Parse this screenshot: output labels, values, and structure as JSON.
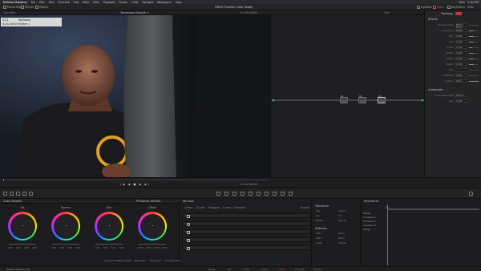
{
  "menubar": {
    "items": [
      "DaVinci Resolve",
      "File",
      "Edit",
      "Trim",
      "Timeline",
      "Clip",
      "Mark",
      "View",
      "Playback",
      "Fusion",
      "Color",
      "Fairlight",
      "Workspace",
      "Help"
    ],
    "right_items": [
      "Mon",
      "1:04 PM"
    ]
  },
  "toolbar": {
    "left_items": [
      "Media Pool",
      "Effects",
      "Gallery"
    ],
    "project_title": "FRESH Timeline (Color Grade)",
    "right_items": [
      "Lightbox",
      "Color",
      "Keyframes",
      "Clips"
    ]
  },
  "viewer": {
    "title": "Tennessee Rain/sh 1",
    "zoom": "Clip 54%",
    "timecode": "01:00:18:02",
    "osd": {
      "row1_left": "V1/1",
      "row1_right": "Keyframe",
      "row2_left": "01:02:16:03",
      "row2_right": "Marker 1"
    }
  },
  "node_editor": {
    "header": "Clip",
    "nodes": [
      {
        "label": "01"
      },
      {
        "label": "02"
      },
      {
        "label": "03"
      }
    ]
  },
  "inspector": {
    "header": "Tracking",
    "tab": "Effects",
    "rows": [
      {
        "label": "Process mode",
        "value": "Effects Fixed",
        "fill": 0
      },
      {
        "label": "Overshoot",
        "value": "0.000",
        "fill": 0.5
      },
      {
        "label": "Pan",
        "value": "0.000",
        "fill": 0.5
      },
      {
        "label": "Tilt",
        "value": "0.000",
        "fill": 0.5
      },
      {
        "label": "Zoom",
        "value": "1.000",
        "fill": 0.3
      },
      {
        "label": "Rotate",
        "value": "0.000",
        "fill": 0.5
      },
      {
        "label": "Width",
        "value": "1.000",
        "fill": 0.5
      },
      {
        "label": "Height",
        "value": "1.000",
        "fill": 0.5
      },
      {
        "label": "Flip",
        "value": "",
        "fill": 0
      },
      {
        "label": "Softness",
        "value": "0.000",
        "fill": 0.1
      },
      {
        "label": "Opacity",
        "value": "100.0",
        "fill": 1.0
      }
    ],
    "section2": "Composite",
    "comp_rows": [
      {
        "label": "Composite mode",
        "value": "Normal"
      },
      {
        "label": "Key",
        "value": "1.000"
      }
    ]
  },
  "color_panel": {
    "title": "Color Wheels",
    "mode": "Primaries Wheels",
    "wheels": [
      {
        "name": "Lift",
        "values": [
          "0.00",
          "0.00",
          "0.00",
          "0.00"
        ]
      },
      {
        "name": "Gamma",
        "values": [
          "0.00",
          "0.00",
          "0.00",
          "0.00"
        ]
      },
      {
        "name": "Gain",
        "values": [
          "1.00",
          "1.00",
          "1.00",
          "1.00"
        ]
      },
      {
        "name": "Offset",
        "values": [
          "25.00",
          "25.00",
          "25.00",
          "25.00"
        ]
      }
    ],
    "bottom": [
      "Contrast 1.000",
      "Pivot 0.435",
      "Sat 50.00",
      "Hue 50.00",
      "Lum Mix 100.00"
    ]
  },
  "curves_panel": {
    "title": "Window",
    "tools": [
      "Linear",
      "Circle",
      "Polygon",
      "Curve",
      "Gradient"
    ],
    "header_right": "Invert"
  },
  "transform_panel": {
    "title": "Transform",
    "rows": [
      "Size",
      "Aspect",
      "Pan",
      "Tilt",
      "Rotate",
      "Opacity"
    ],
    "softness_title": "Softness",
    "soft_rows": [
      "Soft 1",
      "Soft 2",
      "Soft 3",
      "Soft 4",
      "Inside",
      "Outside"
    ]
  },
  "keyframes": {
    "title": "Keyframes",
    "label": "All",
    "rows": [
      "Master",
      "Corrector 1",
      "Corrector 2",
      "Corrector 3",
      "Sizing"
    ]
  },
  "pages": {
    "app_name": "DaVinci Resolve 18",
    "tabs": [
      "Media",
      "Cut",
      "Edit",
      "Fusion",
      "Color",
      "Fairlight",
      "Deliver"
    ],
    "active": "Color"
  }
}
